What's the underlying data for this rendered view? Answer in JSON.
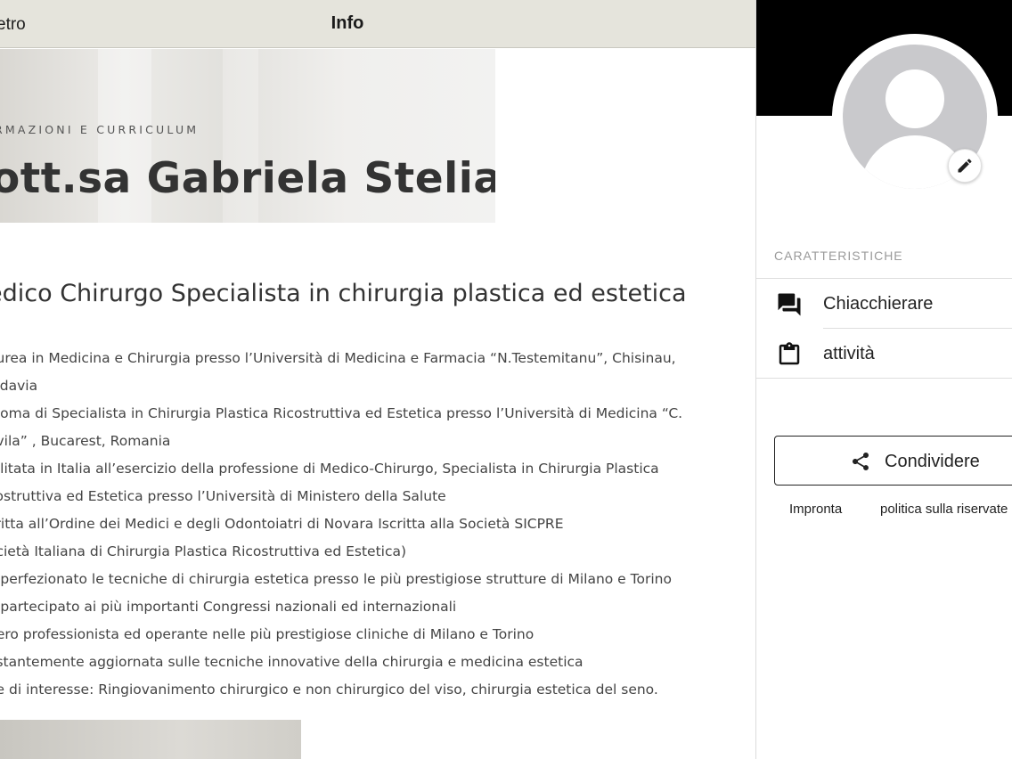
{
  "topbar": {
    "back_label": "etro",
    "title": "Info"
  },
  "hero": {
    "kicker": "RMAZIONI E CURRICULUM",
    "name": "ott.sa Gabriela Stelian"
  },
  "subtitle": "edico Chirurgo Specialista in chirurgia plastica ed estetica",
  "bio_lines": [
    "aurea in Medicina e Chirurgia presso l’Università di Medicina e Farmacia “N.Testemitanu”, Chisinau,",
    "oldavia",
    "ploma di Specialista in Chirurgia Plastica Ricostruttiva ed Estetica presso l’Università di Medicina “C.",
    "avila” , Bucarest, Romania",
    "bilitata in Italia all’esercizio della professione di Medico-Chirurgo, Specialista in Chirurgia Plastica",
    "costruttiva ed Estetica presso l’Università di Ministero della Salute",
    "critta all’Ordine dei Medici e degli Odontoiatri di Novara Iscritta alla Società SICPRE",
    "ocietà Italiana di Chirurgia Plastica Ricostruttiva ed Estetica)",
    "a perfezionato le tecniche di chirurgia estetica presso le più prestigiose strutture di Milano e Torino",
    "a partecipato ai più importanti Congressi nazionali ed internazionali",
    "bero professionista ed operante nelle più prestigiose cliniche di Milano e Torino",
    "ostantemente aggiornata sulle tecniche innovative della chirurgia e medicina estetica",
    "ee di interesse: Ringiovanimento chirurgico e non chirurgico del viso, chirurgia estetica del seno."
  ],
  "sidebar": {
    "section_label": "CARATTERISTICHE",
    "features": [
      {
        "label": "Chiacchierare",
        "icon": "chat-icon"
      },
      {
        "label": "attività",
        "icon": "clipboard-icon"
      }
    ],
    "share_label": "Condividere",
    "share_icon": "share-icon",
    "edit_icon": "pencil-icon",
    "footer_links": [
      "Impronta",
      "politica sulla riservate"
    ]
  },
  "colors": {
    "topbar_bg": "#e5e4dc",
    "cover_bg": "#000000",
    "avatar_gray": "#c9c9cc",
    "text_dark": "#333333"
  }
}
